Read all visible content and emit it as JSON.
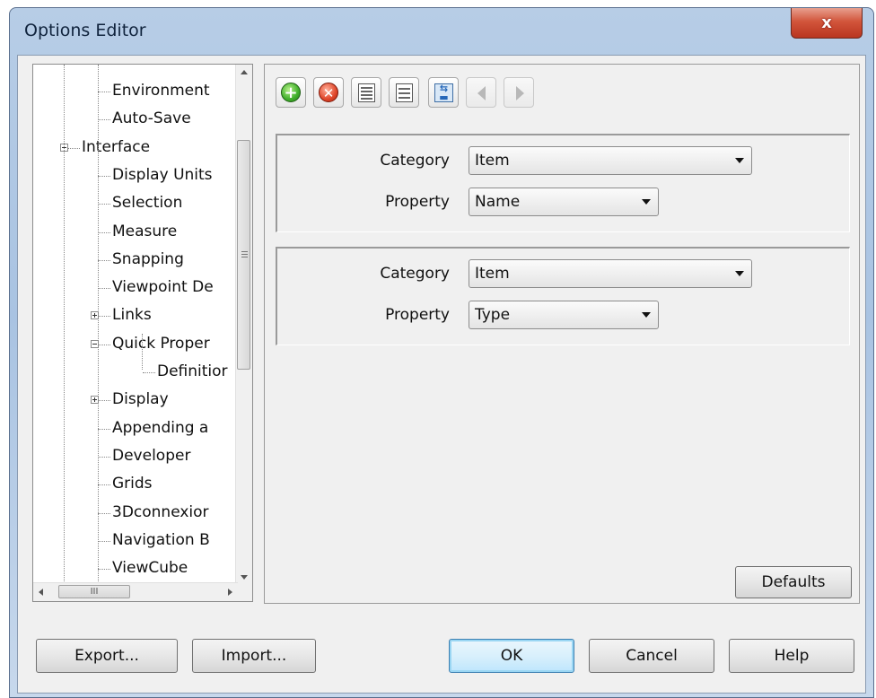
{
  "window": {
    "title": "Options Editor",
    "close_label": "x"
  },
  "tree": {
    "items": [
      {
        "label": "Environment",
        "level": 2
      },
      {
        "label": "Auto-Save",
        "level": 2
      },
      {
        "label": "Interface",
        "level": 1,
        "expander": "minus"
      },
      {
        "label": "Display Units",
        "level": 2
      },
      {
        "label": "Selection",
        "level": 2
      },
      {
        "label": "Measure",
        "level": 2
      },
      {
        "label": "Snapping",
        "level": 2
      },
      {
        "label": "Viewpoint De",
        "level": 2
      },
      {
        "label": "Links",
        "level": 2,
        "expander": "plus"
      },
      {
        "label": "Quick Proper",
        "level": 2,
        "expander": "minus"
      },
      {
        "label": "Definitior",
        "level": 3
      },
      {
        "label": "Display",
        "level": 2,
        "expander": "plus"
      },
      {
        "label": "Appending a",
        "level": 2
      },
      {
        "label": "Developer",
        "level": 2
      },
      {
        "label": "Grids",
        "level": 2
      },
      {
        "label": "3Dconnexior",
        "level": 2
      },
      {
        "label": "Navigation B",
        "level": 2
      },
      {
        "label": "ViewCube",
        "level": 2
      }
    ],
    "hscroll_thumb": "III"
  },
  "toolbar": {
    "buttons": [
      {
        "icon": "add-icon"
      },
      {
        "icon": "delete-icon"
      },
      {
        "icon": "rows-compact-icon"
      },
      {
        "icon": "rows-icon"
      },
      {
        "icon": "swap-icon"
      },
      {
        "icon": "move-left-icon",
        "disabled": true
      },
      {
        "icon": "move-right-icon",
        "disabled": true
      }
    ]
  },
  "definitions": [
    {
      "category_label": "Category",
      "category_value": "Item",
      "property_label": "Property",
      "property_value": "Name"
    },
    {
      "category_label": "Category",
      "category_value": "Item",
      "property_label": "Property",
      "property_value": "Type"
    }
  ],
  "buttons": {
    "defaults": "Defaults",
    "export": "Export...",
    "import": "Import...",
    "ok": "OK",
    "cancel": "Cancel",
    "help": "Help"
  },
  "colors": {
    "title_bar": "#b7cde6",
    "close_button": "#d2553b",
    "dialog_bg": "#f0f0f0"
  }
}
